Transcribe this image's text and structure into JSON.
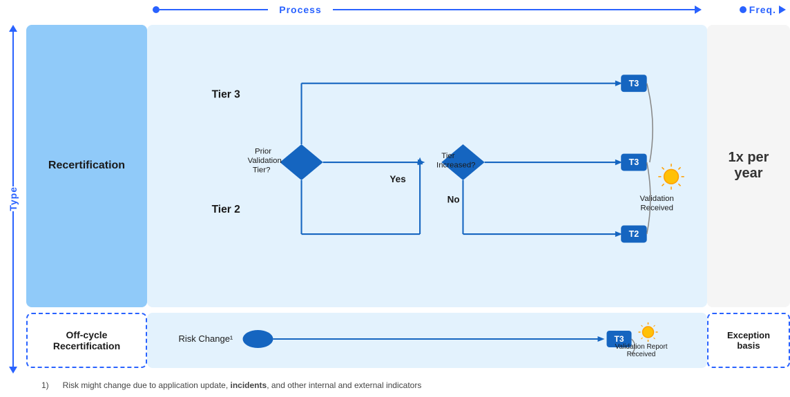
{
  "axes": {
    "process_label": "Process",
    "freq_label": "Freq.",
    "type_label": "Type"
  },
  "recertification": {
    "main_label": "Recertification",
    "offcycle_label": "Off-cycle\nRecertification"
  },
  "flow": {
    "tier3_label": "Tier 3",
    "tier2_label": "Tier 2",
    "prior_validation_label": "Prior\nValidation\nTier?",
    "tier_increased_label": "Tier\nIncreased?",
    "yes_label": "Yes",
    "no_label": "No",
    "t3_badge": "T3",
    "t2_badge": "T2",
    "validation_received_label": "Validation\nReceived"
  },
  "offcycle": {
    "risk_change_label": "Risk Change¹",
    "t3_badge": "T3",
    "validation_report_received_label": "Validation Report\nReceived"
  },
  "freq": {
    "main_value": "1x per\nyear",
    "offcycle_value": "Exception\nbasis"
  },
  "footer": {
    "number": "1)",
    "text": "Risk might change due to application update, ",
    "bold_text": "incidents",
    "text2": ", and other internal and external indicators"
  },
  "colors": {
    "blue_accent": "#2962FF",
    "blue_dark": "#1565C0",
    "blue_light_bg": "#E3F2FD",
    "blue_light_box": "#90CAF9",
    "gray_bg": "#f5f5f5"
  }
}
